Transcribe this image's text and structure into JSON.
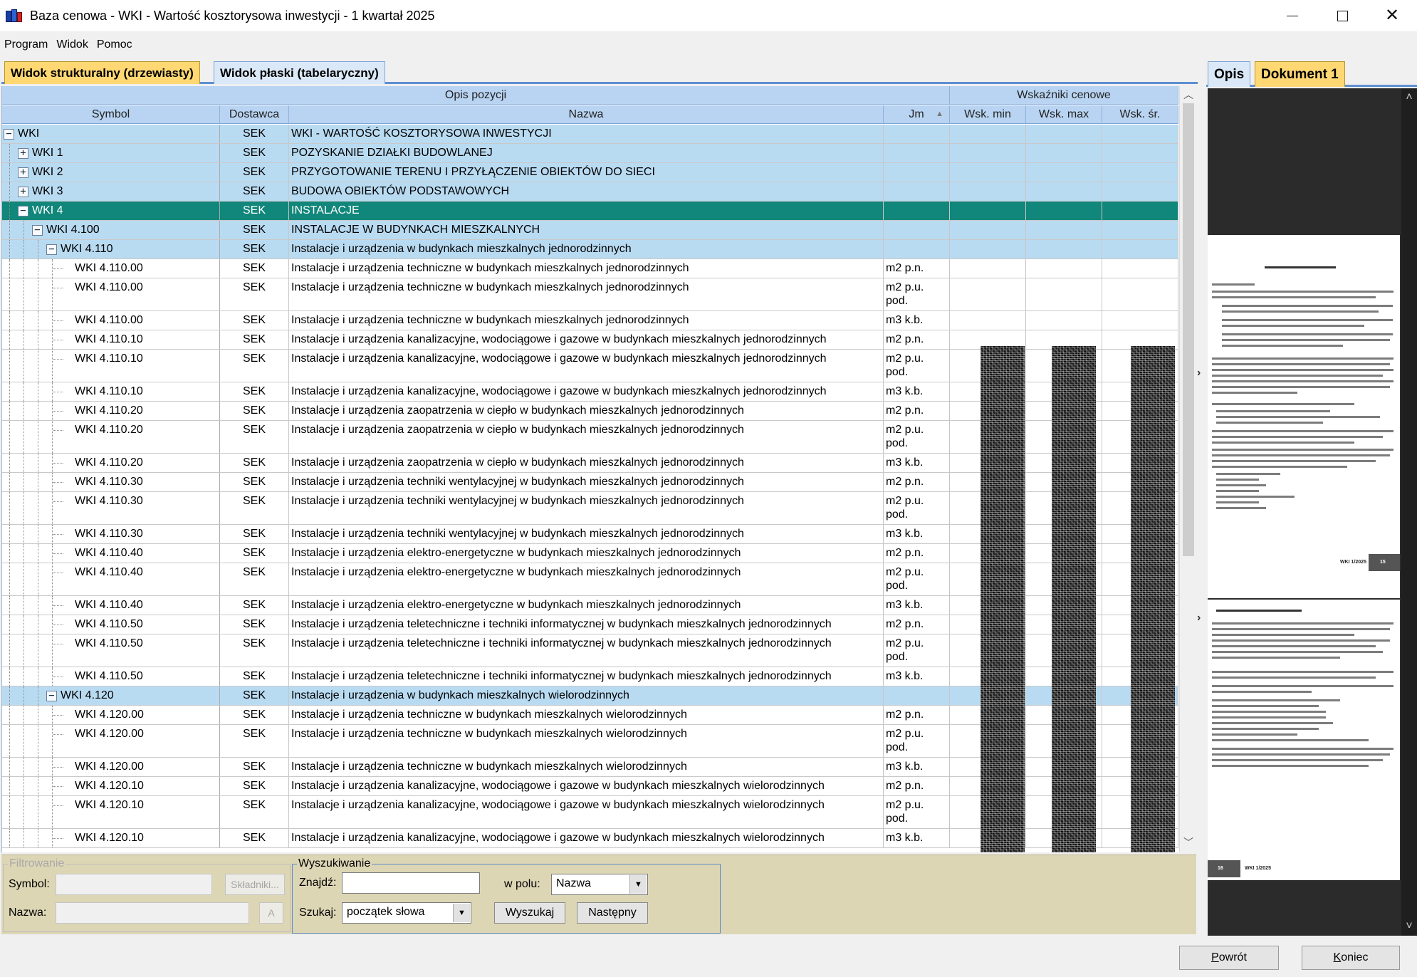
{
  "window": {
    "title": "Baza cenowa - WKI - Wartość kosztorysowa inwestycji - 1 kwartał 2025"
  },
  "menu": [
    "Program",
    "Widok",
    "Pomoc"
  ],
  "tabs": {
    "tree": "Widok strukturalny (drzewiasty)",
    "flat": "Widok płaski (tabelaryczny)"
  },
  "grid": {
    "group_headers": {
      "desc": "Opis pozycji",
      "prices": "Wskaźniki cenowe"
    },
    "columns": {
      "symbol": "Symbol",
      "dostawca": "Dostawca",
      "nazwa": "Nazwa",
      "jm": "Jm",
      "min": "Wsk. min",
      "max": "Wsk. max",
      "sr": "Wsk. śr."
    },
    "rows": [
      {
        "symbol": "WKI",
        "level": 0,
        "toggle": "−",
        "dostawca": "SEK",
        "nazwa": "WKI - WARTOŚĆ KOSZTORYSOWA INWESTYCJI",
        "jm": "",
        "type": "group",
        "h": 1
      },
      {
        "symbol": "WKI 1",
        "level": 1,
        "toggle": "+",
        "dostawca": "SEK",
        "nazwa": "POZYSKANIE DZIAŁKI BUDOWLANEJ",
        "jm": "",
        "type": "group",
        "h": 1
      },
      {
        "symbol": "WKI 2",
        "level": 1,
        "toggle": "+",
        "dostawca": "SEK",
        "nazwa": "PRZYGOTOWANIE TERENU I PRZYŁĄCZENIE OBIEKTÓW DO SIECI",
        "jm": "",
        "type": "group",
        "h": 1
      },
      {
        "symbol": "WKI 3",
        "level": 1,
        "toggle": "+",
        "dostawca": "SEK",
        "nazwa": "BUDOWA OBIEKTÓW PODSTAWOWYCH",
        "jm": "",
        "type": "group",
        "h": 1
      },
      {
        "symbol": "WKI 4",
        "level": 1,
        "toggle": "−",
        "dostawca": "SEK",
        "nazwa": "INSTALACJE",
        "jm": "",
        "type": "selected",
        "h": 1
      },
      {
        "symbol": "WKI 4.100",
        "level": 2,
        "toggle": "−",
        "dostawca": "SEK",
        "nazwa": "INSTALACJE W BUDYNKACH MIESZKALNYCH",
        "jm": "",
        "type": "group",
        "h": 1
      },
      {
        "symbol": "WKI 4.110",
        "level": 3,
        "toggle": "−",
        "dostawca": "SEK",
        "nazwa": "Instalacje i urządzenia w budynkach mieszkalnych jednorodzinnych",
        "jm": "",
        "type": "group",
        "h": 1
      },
      {
        "symbol": "WKI 4.110.00",
        "level": 4,
        "toggle": "",
        "dostawca": "SEK",
        "nazwa": "Instalacje i urządzenia techniczne w budynkach mieszkalnych jednorodzinnych",
        "jm": "m2 p.n.",
        "type": "white",
        "h": 1
      },
      {
        "symbol": "WKI 4.110.00",
        "level": 4,
        "toggle": "",
        "dostawca": "SEK",
        "nazwa": "Instalacje i urządzenia techniczne w budynkach mieszkalnych jednorodzinnych",
        "jm": "m2 p.u. pod.",
        "type": "white",
        "h": 2
      },
      {
        "symbol": "WKI 4.110.00",
        "level": 4,
        "toggle": "",
        "dostawca": "SEK",
        "nazwa": "Instalacje i urządzenia techniczne w budynkach mieszkalnych jednorodzinnych",
        "jm": "m3 k.b.",
        "type": "white",
        "h": 1
      },
      {
        "symbol": "WKI 4.110.10",
        "level": 4,
        "toggle": "",
        "dostawca": "SEK",
        "nazwa": "Instalacje i urządzenia kanalizacyjne, wodociągowe i gazowe w budynkach mieszkalnych jednorodzinnych",
        "jm": "m2 p.n.",
        "type": "white",
        "h": 1
      },
      {
        "symbol": "WKI 4.110.10",
        "level": 4,
        "toggle": "",
        "dostawca": "SEK",
        "nazwa": "Instalacje i urządzenia kanalizacyjne, wodociągowe i gazowe w budynkach mieszkalnych jednorodzinnych",
        "jm": "m2 p.u. pod.",
        "type": "white",
        "h": 2
      },
      {
        "symbol": "WKI 4.110.10",
        "level": 4,
        "toggle": "",
        "dostawca": "SEK",
        "nazwa": "Instalacje i urządzenia kanalizacyjne, wodociągowe i gazowe w budynkach mieszkalnych jednorodzinnych",
        "jm": "m3 k.b.",
        "type": "white",
        "h": 1
      },
      {
        "symbol": "WKI 4.110.20",
        "level": 4,
        "toggle": "",
        "dostawca": "SEK",
        "nazwa": "Instalacje i urządzenia zaopatrzenia w ciepło w budynkach mieszkalnych jednorodzinnych",
        "jm": "m2 p.n.",
        "type": "white",
        "h": 1
      },
      {
        "symbol": "WKI 4.110.20",
        "level": 4,
        "toggle": "",
        "dostawca": "SEK",
        "nazwa": "Instalacje i urządzenia zaopatrzenia w ciepło w budynkach mieszkalnych jednorodzinnych",
        "jm": "m2 p.u. pod.",
        "type": "white",
        "h": 2
      },
      {
        "symbol": "WKI 4.110.20",
        "level": 4,
        "toggle": "",
        "dostawca": "SEK",
        "nazwa": "Instalacje i urządzenia zaopatrzenia w ciepło w budynkach mieszkalnych jednorodzinnych",
        "jm": "m3 k.b.",
        "type": "white",
        "h": 1
      },
      {
        "symbol": "WKI 4.110.30",
        "level": 4,
        "toggle": "",
        "dostawca": "SEK",
        "nazwa": "Instalacje i urządzenia techniki wentylacyjnej w budynkach mieszkalnych jednorodzinnych",
        "jm": "m2 p.n.",
        "type": "white",
        "h": 1
      },
      {
        "symbol": "WKI 4.110.30",
        "level": 4,
        "toggle": "",
        "dostawca": "SEK",
        "nazwa": "Instalacje i urządzenia techniki wentylacyjnej w budynkach mieszkalnych jednorodzinnych",
        "jm": "m2 p.u. pod.",
        "type": "white",
        "h": 2
      },
      {
        "symbol": "WKI 4.110.30",
        "level": 4,
        "toggle": "",
        "dostawca": "SEK",
        "nazwa": "Instalacje i urządzenia techniki wentylacyjnej w budynkach mieszkalnych jednorodzinnych",
        "jm": "m3 k.b.",
        "type": "white",
        "h": 1
      },
      {
        "symbol": "WKI 4.110.40",
        "level": 4,
        "toggle": "",
        "dostawca": "SEK",
        "nazwa": "Instalacje i urządzenia elektro-energetyczne w budynkach mieszkalnych jednorodzinnych",
        "jm": "m2 p.n.",
        "type": "white",
        "h": 1
      },
      {
        "symbol": "WKI 4.110.40",
        "level": 4,
        "toggle": "",
        "dostawca": "SEK",
        "nazwa": "Instalacje i urządzenia elektro-energetyczne w budynkach mieszkalnych jednorodzinnych",
        "jm": "m2 p.u. pod.",
        "type": "white",
        "h": 2
      },
      {
        "symbol": "WKI 4.110.40",
        "level": 4,
        "toggle": "",
        "dostawca": "SEK",
        "nazwa": "Instalacje i urządzenia elektro-energetyczne w budynkach mieszkalnych jednorodzinnych",
        "jm": "m3 k.b.",
        "type": "white",
        "h": 1
      },
      {
        "symbol": "WKI 4.110.50",
        "level": 4,
        "toggle": "",
        "dostawca": "SEK",
        "nazwa": "Instalacje i urządzenia teletechniczne i techniki informatycznej w budynkach mieszkalnych jednorodzinnych",
        "jm": "m2 p.n.",
        "type": "white",
        "h": 1
      },
      {
        "symbol": "WKI 4.110.50",
        "level": 4,
        "toggle": "",
        "dostawca": "SEK",
        "nazwa": "Instalacje i urządzenia teletechniczne i techniki informatycznej w budynkach mieszkalnych jednorodzinnych",
        "jm": "m2 p.u. pod.",
        "type": "white",
        "h": 2
      },
      {
        "symbol": "WKI 4.110.50",
        "level": 4,
        "toggle": "",
        "dostawca": "SEK",
        "nazwa": "Instalacje i urządzenia teletechniczne i techniki informatycznej w budynkach mieszkalnych jednorodzinnych",
        "jm": "m3 k.b.",
        "type": "white",
        "h": 1
      },
      {
        "symbol": "WKI 4.120",
        "level": 3,
        "toggle": "−",
        "dostawca": "SEK",
        "nazwa": "Instalacje i urządzenia w budynkach mieszkalnych wielorodzinnych",
        "jm": "",
        "type": "group",
        "h": 1
      },
      {
        "symbol": "WKI 4.120.00",
        "level": 4,
        "toggle": "",
        "dostawca": "SEK",
        "nazwa": "Instalacje i urządzenia techniczne w budynkach mieszkalnych wielorodzinnych",
        "jm": "m2 p.n.",
        "type": "white",
        "h": 1
      },
      {
        "symbol": "WKI 4.120.00",
        "level": 4,
        "toggle": "",
        "dostawca": "SEK",
        "nazwa": "Instalacje i urządzenia techniczne w budynkach mieszkalnych wielorodzinnych",
        "jm": "m2 p.u. pod.",
        "type": "white",
        "h": 2
      },
      {
        "symbol": "WKI 4.120.00",
        "level": 4,
        "toggle": "",
        "dostawca": "SEK",
        "nazwa": "Instalacje i urządzenia techniczne w budynkach mieszkalnych wielorodzinnych",
        "jm": "m3 k.b.",
        "type": "white",
        "h": 1
      },
      {
        "symbol": "WKI 4.120.10",
        "level": 4,
        "toggle": "",
        "dostawca": "SEK",
        "nazwa": "Instalacje i urządzenia kanalizacyjne, wodociągowe i gazowe w budynkach mieszkalnych wielorodzinnych",
        "jm": "m2 p.n.",
        "type": "white",
        "h": 1
      },
      {
        "symbol": "WKI 4.120.10",
        "level": 4,
        "toggle": "",
        "dostawca": "SEK",
        "nazwa": "Instalacje i urządzenia kanalizacyjne, wodociągowe i gazowe w budynkach mieszkalnych wielorodzinnych",
        "jm": "m2 p.u. pod.",
        "type": "white",
        "h": 2
      },
      {
        "symbol": "WKI 4.120.10",
        "level": 4,
        "toggle": "",
        "dostawca": "SEK",
        "nazwa": "Instalacje i urządzenia kanalizacyjne, wodociągowe i gazowe w budynkach mieszkalnych wielorodzinnych",
        "jm": "m3 k.b.",
        "type": "white",
        "h": 1
      }
    ]
  },
  "filter": {
    "legend": "Filtrowanie",
    "symbol_label": "Symbol:",
    "nazwa_label": "Nazwa:",
    "skladniki_button": "Składniki...",
    "small_button": "A"
  },
  "search": {
    "legend": "Wyszukiwanie",
    "znajdz_label": "Znajdź:",
    "znajdz_value": "",
    "w_polu_label": "w polu:",
    "w_polu_value": "Nazwa",
    "szukaj_label": "Szukaj:",
    "szukaj_value": "początek słowa",
    "wyszukaj_button": "Wyszukaj",
    "nastepny_button": "Następny"
  },
  "right_panel": {
    "tab_opis": "Opis",
    "tab_dokument": "Dokument 1",
    "page1_heading": "GRUPA KOSZTÓW 4 - INSTALACJE",
    "page1_footer": "WKI 1/2025",
    "page1_number": "15",
    "page2_heading": "GRUPA KOSZTÓW 4 - INSTALACJE",
    "page2_number": "16",
    "page2_footer": "WKI 1/2025"
  },
  "footer": {
    "back": "Powrót",
    "back_key": "P",
    "back_rest": "owrót",
    "end": "Koniec",
    "end_key": "K",
    "end_rest": "oniec"
  }
}
